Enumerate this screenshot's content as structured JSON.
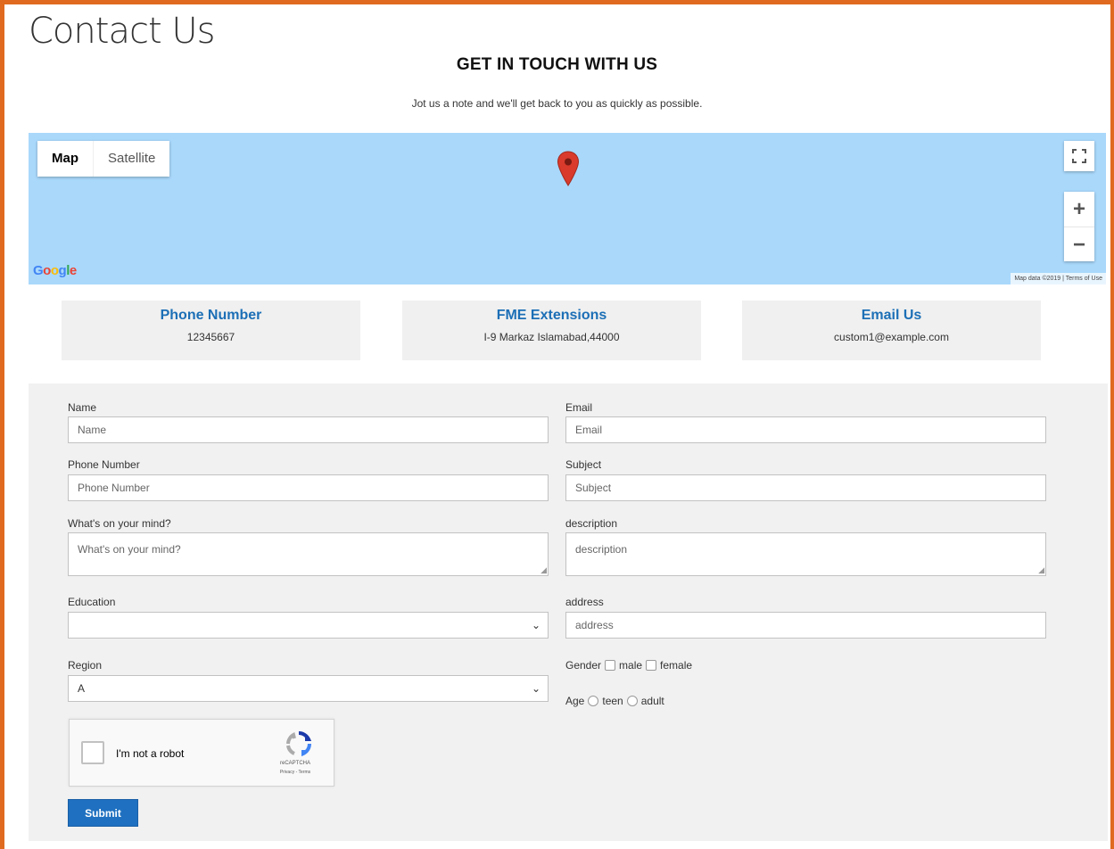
{
  "page": {
    "title": "Contact Us",
    "headline": "GET IN TOUCH WITH US",
    "subheadline": "Jot us a note and we'll get back to you as quickly as possible."
  },
  "map": {
    "map_tab": "Map",
    "satellite_tab": "Satellite",
    "zoom_in": "+",
    "zoom_out": "−",
    "google_logo": "Google",
    "attribution": "Map data ©2019 | Terms of Use",
    "pin_color": "#d93a2b",
    "background_color": "#a9d8fb"
  },
  "cards": [
    {
      "title": "Phone Number",
      "value": "12345667"
    },
    {
      "title": "FME Extensions",
      "value": "I-9 Markaz Islamabad,44000"
    },
    {
      "title": "Email Us",
      "value": "custom1@example.com"
    }
  ],
  "form": {
    "name": {
      "label": "Name",
      "placeholder": "Name"
    },
    "email": {
      "label": "Email",
      "placeholder": "Email"
    },
    "phone": {
      "label": "Phone Number",
      "placeholder": "Phone Number"
    },
    "subject": {
      "label": "Subject",
      "placeholder": "Subject"
    },
    "mind": {
      "label": "What's on your mind?",
      "placeholder": "What's on your mind?"
    },
    "description": {
      "label": "description",
      "placeholder": "description"
    },
    "education": {
      "label": "Education",
      "value": ""
    },
    "address": {
      "label": "address",
      "placeholder": "address"
    },
    "region": {
      "label": "Region",
      "value": "A"
    },
    "gender": {
      "label": "Gender",
      "options": [
        "male",
        "female"
      ]
    },
    "age": {
      "label": "Age",
      "options": [
        "teen",
        "adult"
      ]
    },
    "captcha": {
      "label": "I'm not a robot",
      "brand": "reCAPTCHA",
      "terms": "Privacy - Terms"
    },
    "submit_label": "Submit"
  },
  "colors": {
    "accent_border": "#e06a1f",
    "link_blue": "#1c6fb6",
    "submit_blue": "#1f70c0"
  }
}
